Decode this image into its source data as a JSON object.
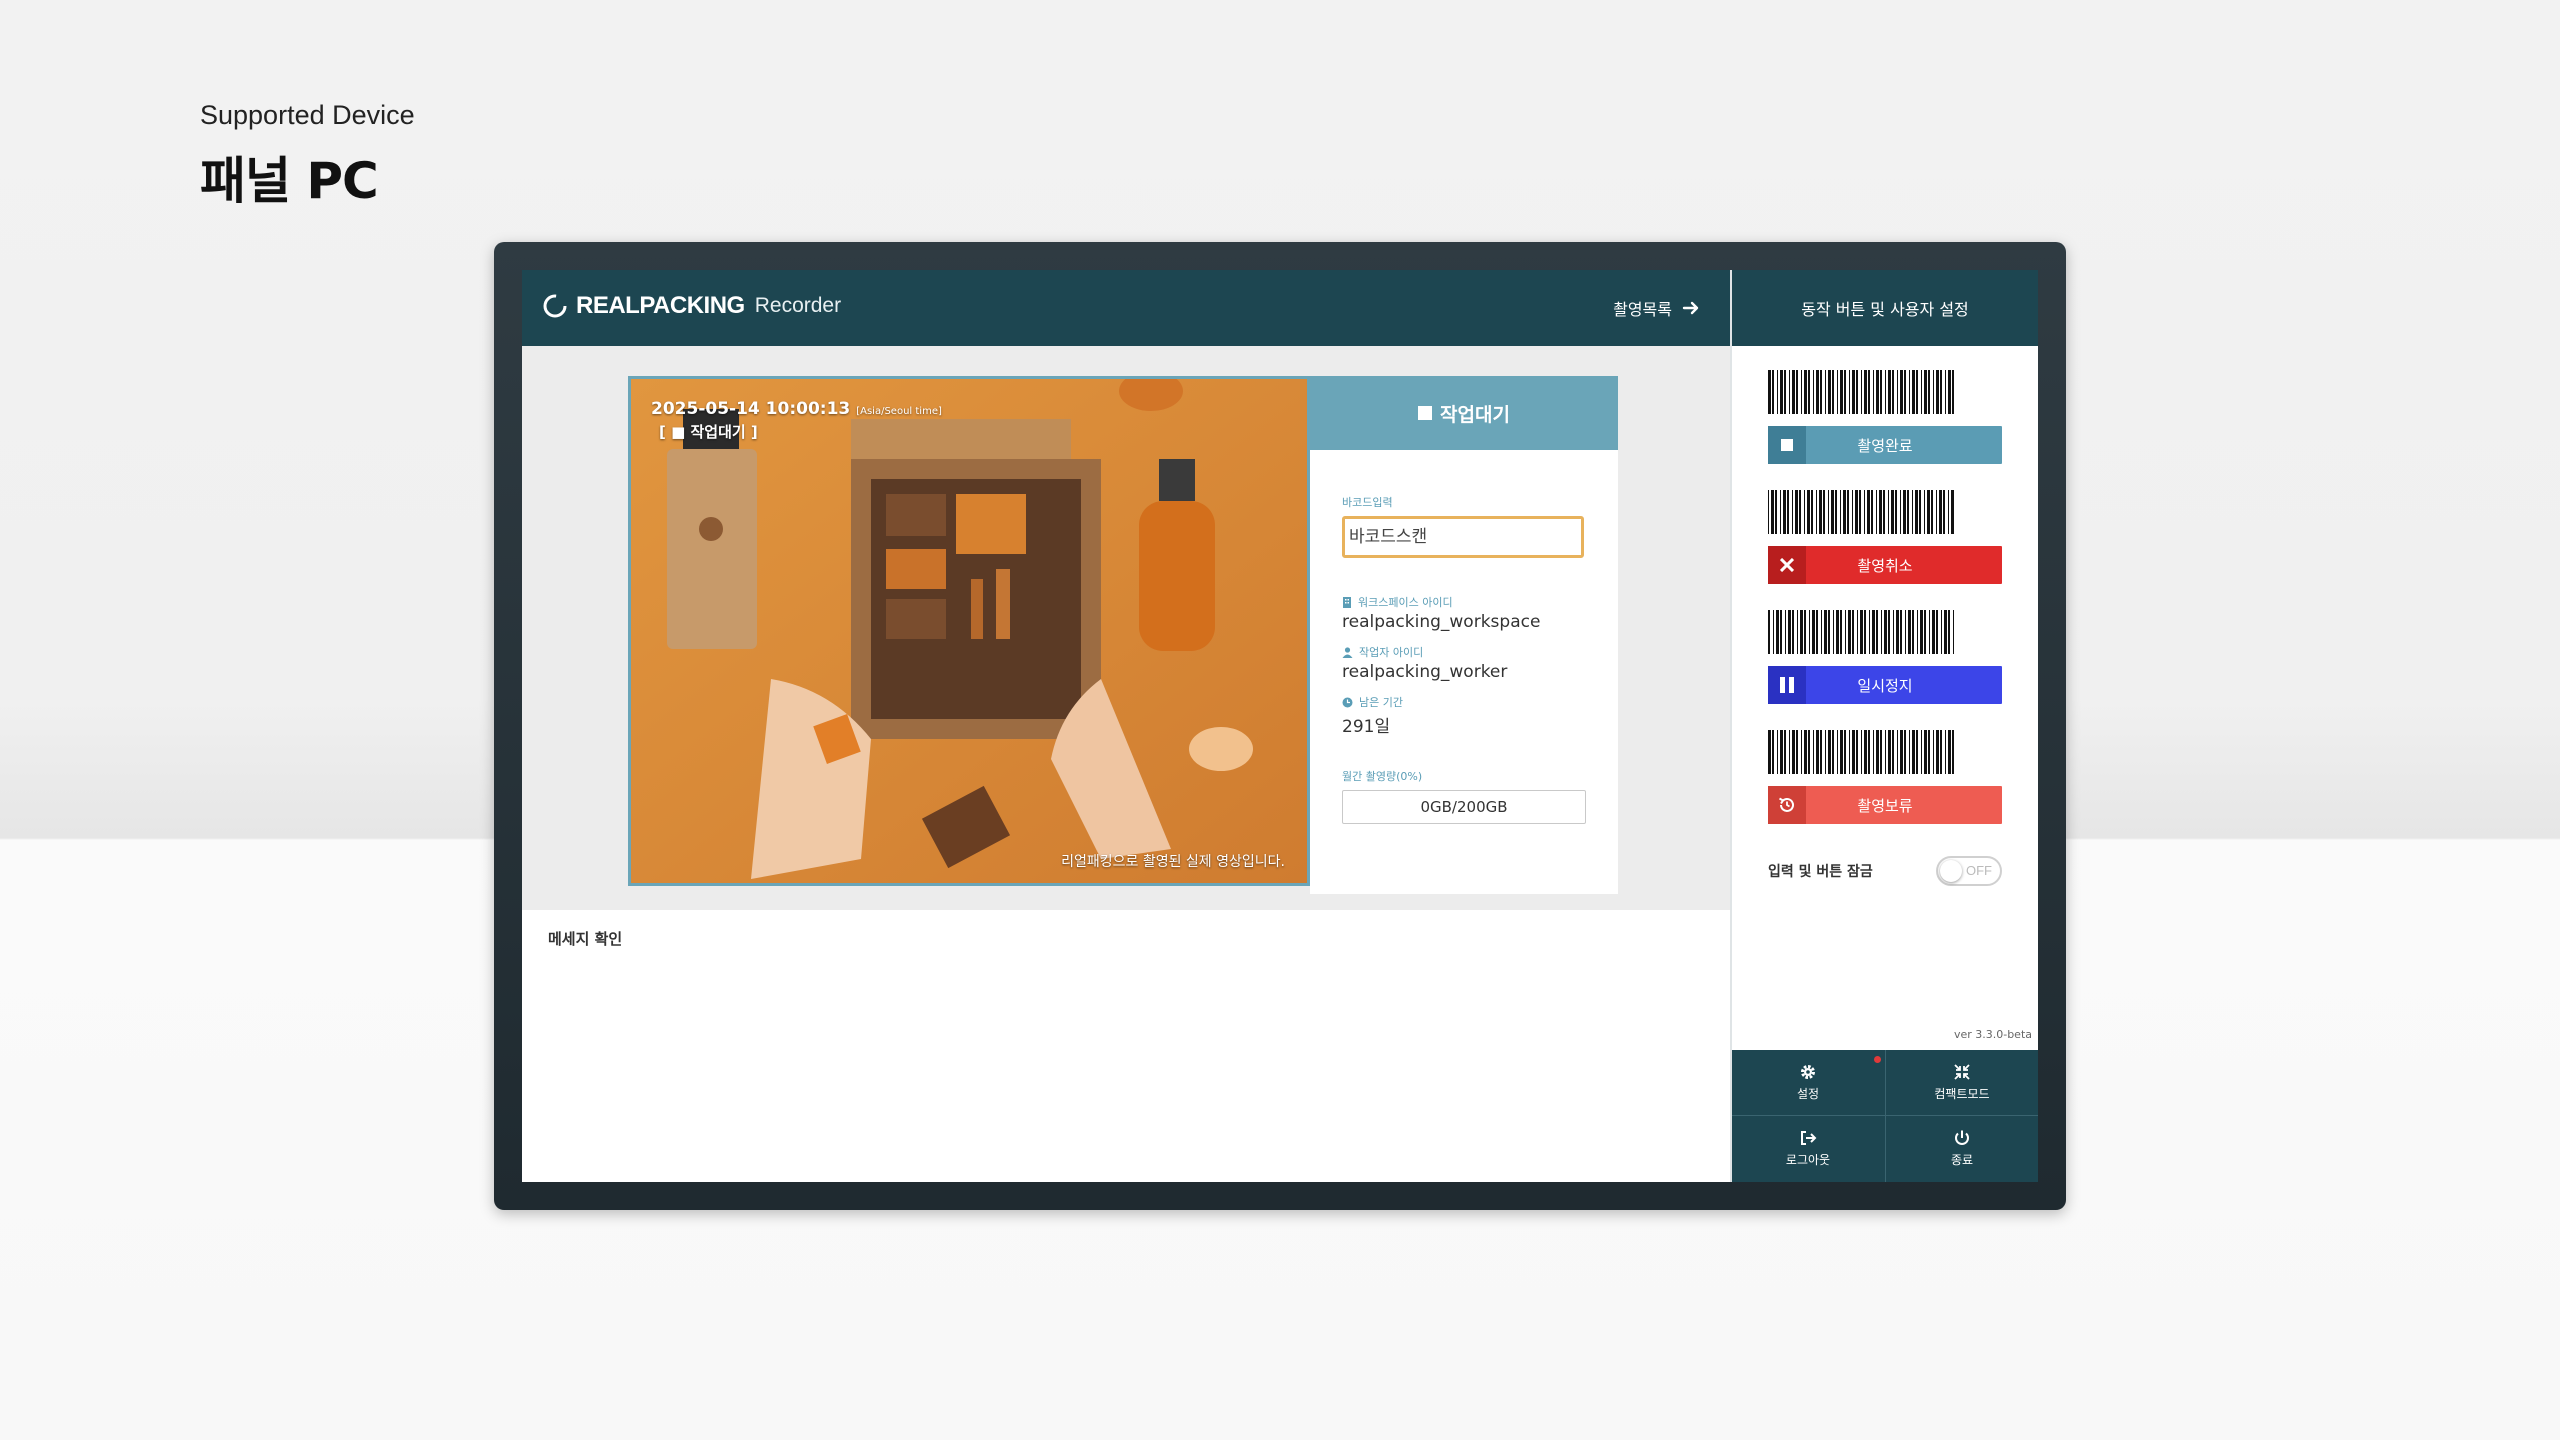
{
  "page": {
    "subtitle": "Supported Device",
    "title": "패널 PC"
  },
  "app": {
    "brand": "REALPACKING",
    "app_name": "Recorder",
    "recording_list_label": "촬영목록",
    "side_title": "동작 버튼 및 사용자 설정"
  },
  "video": {
    "timestamp": "2025-05-14 10:00:13",
    "timezone": "[Asia/Seoul time]",
    "status_overlay": "[ ■ 작업대기 ]",
    "caption": "리얼패킹으로 촬영된 실제 영상입니다."
  },
  "status_panel": {
    "status": "작업대기",
    "barcode_label": "바코드입력",
    "barcode_placeholder": "바코드스캔",
    "workspace_label": "워크스페이스 아이디",
    "workspace_value": "realpacking_workspace",
    "worker_label": "작업자 아이디",
    "worker_value": "realpacking_worker",
    "remaining_label": "남은 기간",
    "remaining_value": "291일",
    "storage_label": "월간 촬영량(0%)",
    "storage_value": "0GB/200GB"
  },
  "messages": {
    "title": "메세지 확인"
  },
  "actions": [
    {
      "label": "촬영완료",
      "icon": "stop-icon",
      "color": "#5b9cb4",
      "icon_bg": "#3f7e96"
    },
    {
      "label": "촬영취소",
      "icon": "close-icon",
      "color": "#e02b2b",
      "icon_bg": "#b81e1e"
    },
    {
      "label": "일시정지",
      "icon": "pause-icon",
      "color": "#3c45e8",
      "icon_bg": "#2a31c2"
    },
    {
      "label": "촬영보류",
      "icon": "history-icon",
      "color": "#ee5c52",
      "icon_bg": "#cf4037"
    }
  ],
  "lock": {
    "label": "입력 및 버튼 잠금",
    "state": "OFF"
  },
  "version": "ver 3.3.0-beta",
  "bottom_menu": [
    {
      "label": "설정",
      "icon": "gear-icon"
    },
    {
      "label": "컴팩트모드",
      "icon": "compress-icon"
    },
    {
      "label": "로그아웃",
      "icon": "logout-icon"
    },
    {
      "label": "종료",
      "icon": "power-icon"
    }
  ],
  "colors": {
    "header": "#1d4651",
    "accent": "#6aa5b8",
    "input_border": "#e8b25c"
  }
}
